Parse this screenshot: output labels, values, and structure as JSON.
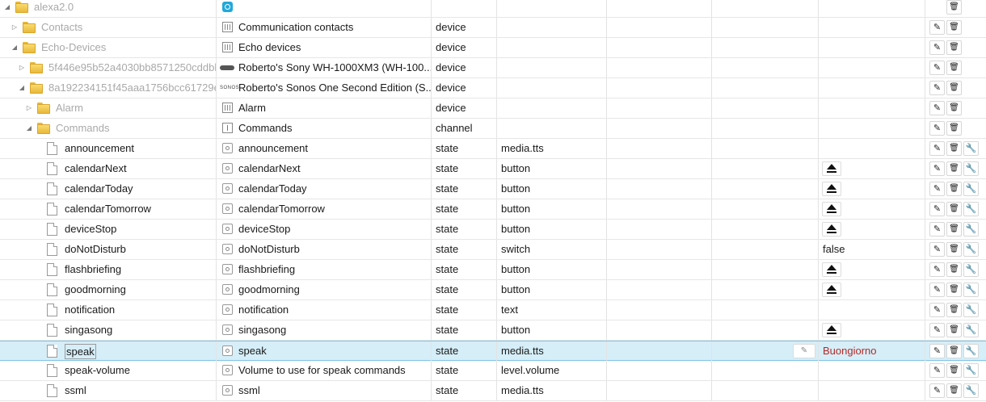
{
  "rows": [
    {
      "id": "alexa2.0",
      "name": "",
      "name_icon": "alexa",
      "type": "",
      "role": "",
      "value": "",
      "kind": "folder",
      "depth": 0,
      "tri": "down",
      "id_muted": true,
      "actions": [
        "delete"
      ]
    },
    {
      "id": "Contacts",
      "name": "Communication contacts",
      "name_icon": "device",
      "type": "device",
      "role": "",
      "value": "",
      "kind": "folder",
      "depth": 1,
      "tri": "right",
      "id_muted": true,
      "actions": [
        "edit",
        "delete"
      ]
    },
    {
      "id": "Echo-Devices",
      "name": "Echo devices",
      "name_icon": "device",
      "type": "device",
      "role": "",
      "value": "",
      "kind": "folder",
      "depth": 1,
      "tri": "down",
      "id_muted": true,
      "actions": [
        "edit",
        "delete"
      ]
    },
    {
      "id": "5f446e95b52a4030bb8571250cddbb",
      "name": "Roberto's Sony WH-1000XM3 (WH-100...",
      "name_icon": "headphones",
      "type": "device",
      "role": "",
      "value": "",
      "kind": "folder",
      "depth": 2,
      "tri": "right",
      "id_muted": true,
      "actions": [
        "edit",
        "delete"
      ]
    },
    {
      "id": "8a192234151f45aaa1756bcc61729e",
      "name": "Roberto's Sonos One Second Edition (S...",
      "name_icon": "sonos",
      "type": "device",
      "role": "",
      "value": "",
      "kind": "folder",
      "depth": 2,
      "tri": "down",
      "id_muted": true,
      "actions": [
        "edit",
        "delete"
      ]
    },
    {
      "id": "Alarm",
      "name": "Alarm",
      "name_icon": "device",
      "type": "device",
      "role": "",
      "value": "",
      "kind": "folder",
      "depth": 3,
      "tri": "right",
      "id_muted": true,
      "actions": [
        "edit",
        "delete"
      ]
    },
    {
      "id": "Commands",
      "name": "Commands",
      "name_icon": "channel",
      "type": "channel",
      "role": "",
      "value": "",
      "kind": "folder",
      "depth": 3,
      "tri": "down",
      "id_muted": true,
      "actions": [
        "edit",
        "delete"
      ]
    },
    {
      "id": "announcement",
      "name": "announcement",
      "name_icon": "state",
      "type": "state",
      "role": "media.tts",
      "value": "",
      "kind": "doc",
      "depth": 4,
      "actions": [
        "edit",
        "delete",
        "settings"
      ]
    },
    {
      "id": "calendarNext",
      "name": "calendarNext",
      "name_icon": "state",
      "type": "state",
      "role": "button",
      "value": "eject",
      "kind": "doc",
      "depth": 4,
      "actions": [
        "edit",
        "delete",
        "settings"
      ]
    },
    {
      "id": "calendarToday",
      "name": "calendarToday",
      "name_icon": "state",
      "type": "state",
      "role": "button",
      "value": "eject",
      "kind": "doc",
      "depth": 4,
      "actions": [
        "edit",
        "delete",
        "settings"
      ]
    },
    {
      "id": "calendarTomorrow",
      "name": "calendarTomorrow",
      "name_icon": "state",
      "type": "state",
      "role": "button",
      "value": "eject",
      "kind": "doc",
      "depth": 4,
      "actions": [
        "edit",
        "delete",
        "settings"
      ]
    },
    {
      "id": "deviceStop",
      "name": "deviceStop",
      "name_icon": "state",
      "type": "state",
      "role": "button",
      "value": "eject",
      "kind": "doc",
      "depth": 4,
      "actions": [
        "edit",
        "delete",
        "settings"
      ]
    },
    {
      "id": "doNotDisturb",
      "name": "doNotDisturb",
      "name_icon": "state",
      "type": "state",
      "role": "switch",
      "value": "false",
      "kind": "doc",
      "depth": 4,
      "actions": [
        "edit",
        "delete",
        "settings"
      ]
    },
    {
      "id": "flashbriefing",
      "name": "flashbriefing",
      "name_icon": "state",
      "type": "state",
      "role": "button",
      "value": "eject",
      "kind": "doc",
      "depth": 4,
      "actions": [
        "edit",
        "delete",
        "settings"
      ]
    },
    {
      "id": "goodmorning",
      "name": "goodmorning",
      "name_icon": "state",
      "type": "state",
      "role": "button",
      "value": "eject",
      "kind": "doc",
      "depth": 4,
      "actions": [
        "edit",
        "delete",
        "settings"
      ]
    },
    {
      "id": "notification",
      "name": "notification",
      "name_icon": "state",
      "type": "state",
      "role": "text",
      "value": "",
      "kind": "doc",
      "depth": 4,
      "actions": [
        "edit",
        "delete",
        "settings"
      ]
    },
    {
      "id": "singasong",
      "name": "singasong",
      "name_icon": "state",
      "type": "state",
      "role": "button",
      "value": "eject",
      "kind": "doc",
      "depth": 4,
      "actions": [
        "edit",
        "delete",
        "settings"
      ]
    },
    {
      "id": "speak",
      "name": "speak",
      "name_icon": "state",
      "type": "state",
      "role": "media.tts",
      "value": "Buongiorno",
      "value_color": "#b22a2a",
      "editing": true,
      "selected": true,
      "kind": "doc",
      "depth": 4,
      "actions": [
        "edit",
        "delete",
        "settings"
      ]
    },
    {
      "id": "speak-volume",
      "name": "Volume to use for speak commands",
      "name_icon": "state",
      "type": "state",
      "role": "level.volume",
      "value": "",
      "kind": "doc",
      "depth": 4,
      "actions": [
        "edit",
        "delete",
        "settings"
      ]
    },
    {
      "id": "ssml",
      "name": "ssml",
      "name_icon": "state",
      "type": "state",
      "role": "media.tts",
      "value": "",
      "kind": "doc",
      "depth": 4,
      "actions": [
        "edit",
        "delete",
        "settings"
      ]
    }
  ],
  "action_glyphs": {
    "edit": "✎",
    "delete": "🗑",
    "settings": "🔧"
  },
  "colors": {
    "selected_bg": "#d6eef8",
    "selected_border": "#7fc4e4",
    "muted_text": "#a9a9a9",
    "value_red": "#b22a2a"
  }
}
